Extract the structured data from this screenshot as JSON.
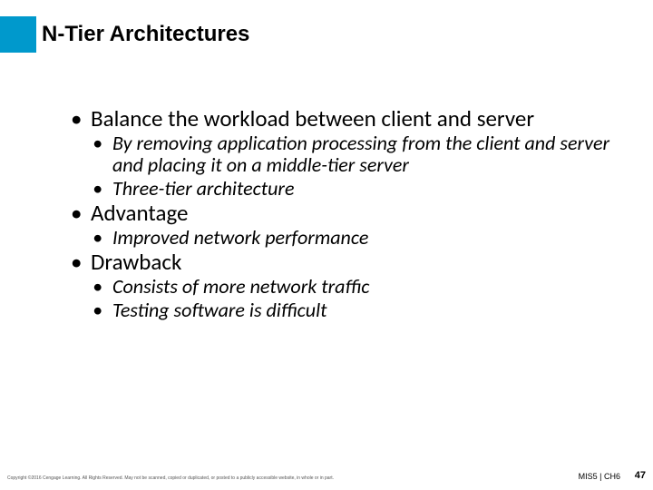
{
  "title": "N-Tier Architectures",
  "bullets": {
    "b1": "Balance the workload between client and server",
    "b1a": "By removing application processing from the client and server and placing it on a middle-tier server",
    "b1b": "Three-tier architecture",
    "b2": "Advantage",
    "b2a": "Improved network performance",
    "b3": "Drawback",
    "b3a": "Consists of more network traffic",
    "b3b": "Testing software is difficult"
  },
  "footer": {
    "copyright": "Copyright ©2016 Cengage Learning. All Rights Reserved. May not be scanned, copied or duplicated, or posted to a publicly accessible website, in whole or in part.",
    "book": "MIS5 | CH6",
    "page": "47"
  }
}
